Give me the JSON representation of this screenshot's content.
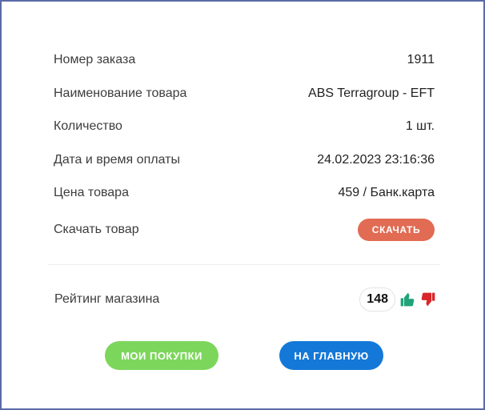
{
  "order": {
    "rows": [
      {
        "label": "Номер заказа",
        "value": "1911"
      },
      {
        "label": "Наименование товара",
        "value": "ABS Terragroup - EFT"
      },
      {
        "label": "Количество",
        "value": "1 шт."
      },
      {
        "label": "Дата и время оплаты",
        "value": "24.02.2023 23:16:36"
      },
      {
        "label": "Цена товара",
        "value": "459 / Банк.карта"
      }
    ],
    "download": {
      "label": "Скачать товар",
      "button_label": "СКАЧАТЬ"
    }
  },
  "rating": {
    "label": "Рейтинг магазина",
    "count": "148",
    "up_icon": "thumbs-up-icon",
    "down_icon": "thumbs-down-icon"
  },
  "actions": {
    "purchases_label": "МОИ ПОКУПКИ",
    "home_label": "НА ГЛАВНУЮ"
  },
  "colors": {
    "download_button": "#e26b53",
    "purchases_button": "#7dd65c",
    "home_button": "#1478d8",
    "thumb_up": "#21a37a",
    "thumb_down": "#d9262a",
    "frame_border": "#5b6aa8"
  }
}
